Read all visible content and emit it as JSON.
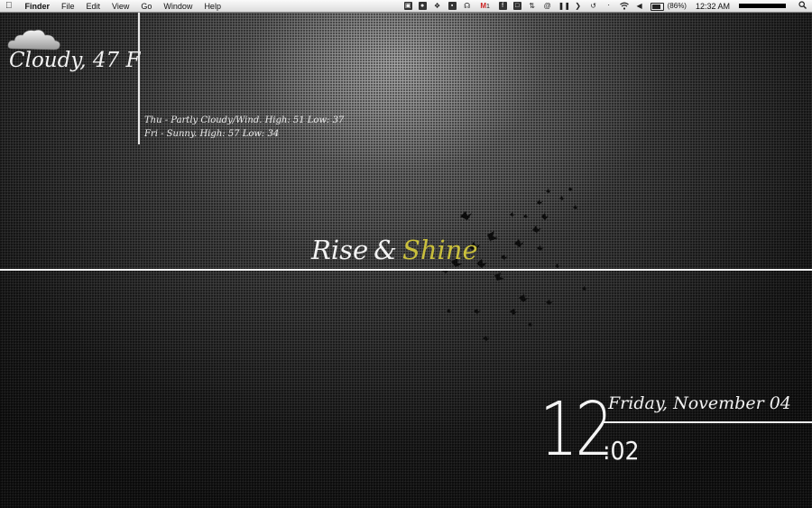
{
  "menubar": {
    "apple_icon": "apple-icon",
    "app_name": "Finder",
    "menus": [
      "File",
      "Edit",
      "View",
      "Go",
      "Window",
      "Help"
    ],
    "gmail_count": "1",
    "battery_percent": "(86%)",
    "time": "12:32 AM",
    "status_icons": [
      "screen-icon",
      "evernote-icon",
      "dropbox-icon",
      "box-icon",
      "headphones-icon",
      "gmail-icon",
      "facebook-icon",
      "window-icon",
      "sync-icon",
      "at-icon",
      "pause-icon",
      "arrow-icon",
      "time-machine-icon",
      "bluetooth-icon",
      "wifi-icon",
      "volume-icon",
      "battery-icon",
      "spotlight-icon"
    ]
  },
  "weather": {
    "current": "Cloudy, 47 F",
    "forecast": [
      "Thu - Partly Cloudy/Wind. High: 51 Low: 37",
      "Fri - Sunny. High: 57 Low: 34"
    ]
  },
  "tagline": {
    "part1": "Rise",
    "ampersand": "&",
    "part2": "Shine",
    "accent_color": "#c9bf3c"
  },
  "clock": {
    "hour": "12",
    "minute": ":02",
    "date": "Friday, November 04"
  }
}
